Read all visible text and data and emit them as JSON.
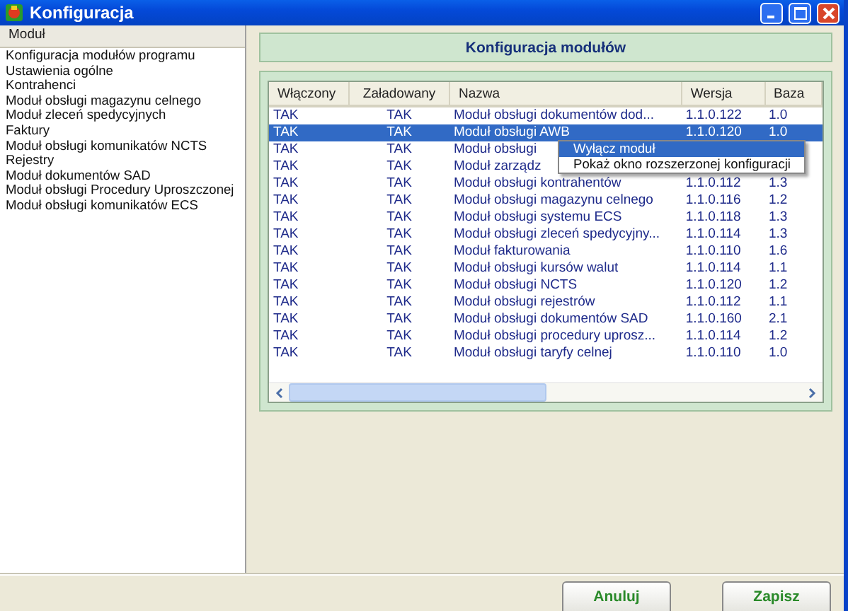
{
  "window": {
    "title": "Konfiguracja"
  },
  "sidebar": {
    "header": "Moduł",
    "items": [
      {
        "label": "Konfiguracja modułów programu",
        "selected": false
      },
      {
        "label": "Ustawienia ogólne",
        "selected": false
      },
      {
        "label": "Kontrahenci",
        "selected": false
      },
      {
        "label": "Moduł obsługi magazynu celnego",
        "selected": false
      },
      {
        "label": "Moduł zleceń spedycyjnych",
        "selected": false
      },
      {
        "label": "Faktury",
        "selected": false
      },
      {
        "label": "Moduł obsługi komunikatów NCTS",
        "selected": false
      },
      {
        "label": "Rejestry",
        "selected": false
      },
      {
        "label": "Moduł dokumentów SAD",
        "selected": false
      },
      {
        "label": "Moduł obsługi Procedury Uproszczonej",
        "selected": false
      },
      {
        "label": "Moduł obsługi komunikatów ECS",
        "selected": false
      }
    ]
  },
  "panel": {
    "title": "Konfiguracja modułów"
  },
  "table": {
    "columns": [
      "Włączony",
      "Załadowany",
      "Nazwa",
      "Wersja",
      "Baza"
    ],
    "rows": [
      {
        "enabled": "TAK",
        "loaded": "TAK",
        "name": "Moduł obsługi dokumentów dod...",
        "version": "1.1.0.122",
        "base": "1.0",
        "selected": false
      },
      {
        "enabled": "TAK",
        "loaded": "TAK",
        "name": "Moduł obsługi AWB",
        "version": "1.1.0.120",
        "base": "1.0",
        "selected": true
      },
      {
        "enabled": "TAK",
        "loaded": "TAK",
        "name": "Moduł obsługi",
        "selected": false
      },
      {
        "enabled": "TAK",
        "loaded": "TAK",
        "name": "Moduł zarządz",
        "selected": false
      },
      {
        "enabled": "TAK",
        "loaded": "TAK",
        "name": "Moduł obsługi kontrahentów",
        "version": "1.1.0.112",
        "base": "1.3",
        "selected": false
      },
      {
        "enabled": "TAK",
        "loaded": "TAK",
        "name": "Moduł obsługi magazynu celnego",
        "version": "1.1.0.116",
        "base": "1.2",
        "selected": false
      },
      {
        "enabled": "TAK",
        "loaded": "TAK",
        "name": "Moduł obsługi systemu ECS",
        "version": "1.1.0.118",
        "base": "1.3",
        "selected": false
      },
      {
        "enabled": "TAK",
        "loaded": "TAK",
        "name": "Moduł obsługi zleceń spedycyjny...",
        "version": "1.1.0.114",
        "base": "1.3",
        "selected": false
      },
      {
        "enabled": "TAK",
        "loaded": "TAK",
        "name": "Moduł fakturowania",
        "version": "1.1.0.110",
        "base": "1.6",
        "selected": false
      },
      {
        "enabled": "TAK",
        "loaded": "TAK",
        "name": "Moduł obsługi kursów walut",
        "version": "1.1.0.114",
        "base": "1.1",
        "selected": false
      },
      {
        "enabled": "TAK",
        "loaded": "TAK",
        "name": "Moduł obsługi NCTS",
        "version": "1.1.0.120",
        "base": "1.2",
        "selected": false
      },
      {
        "enabled": "TAK",
        "loaded": "TAK",
        "name": "Moduł obsługi rejestrów",
        "version": "1.1.0.112",
        "base": "1.1",
        "selected": false
      },
      {
        "enabled": "TAK",
        "loaded": "TAK",
        "name": "Moduł obsługi dokumentów SAD",
        "version": "1.1.0.160",
        "base": "2.1",
        "selected": false
      },
      {
        "enabled": "TAK",
        "loaded": "TAK",
        "name": "Moduł obsługi procedury uprosz...",
        "version": "1.1.0.114",
        "base": "1.2",
        "selected": false
      },
      {
        "enabled": "TAK",
        "loaded": "TAK",
        "name": "Moduł obsługi taryfy celnej",
        "version": "1.1.0.110",
        "base": "1.0",
        "selected": false
      }
    ]
  },
  "context_menu": {
    "items": [
      {
        "label": "Wyłącz moduł",
        "selected": true
      },
      {
        "label": "Pokaż okno rozszerzonej konfiguracji",
        "selected": false
      }
    ]
  },
  "buttons": [
    "Anuluj",
    "Zapisz"
  ]
}
